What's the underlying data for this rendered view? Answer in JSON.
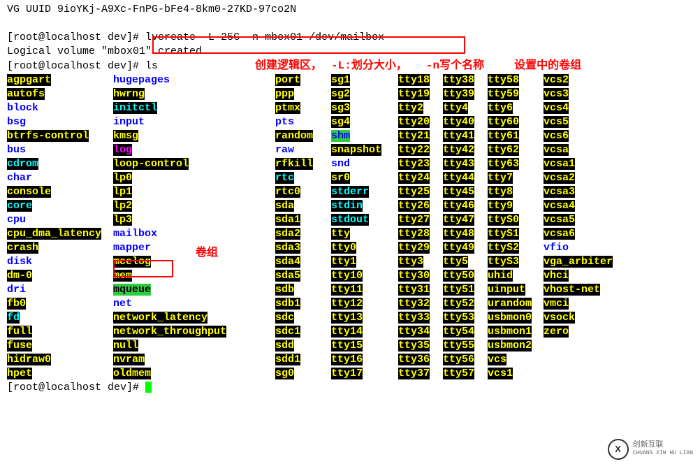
{
  "header_line": "  VG UUID               9ioYKj-A9Xc-FnPG-bFe4-8km0-27KD-97co2N",
  "prompt1": "[root@localhost dev]# ",
  "cmd1": "lvcreate -L 25G -n mbox01 /dev/mailbox",
  "result_line": "  Logical volume \"mbox01\" created.",
  "prompt2": "[root@localhost dev]# ",
  "cmd2": "ls",
  "anno_create": "创建逻辑区，",
  "anno_L": "-L:划分大小，",
  "anno_n": "-n写个名称",
  "anno_vg": "设置中的卷组",
  "anno_group": "卷组",
  "cols": [
    [
      {
        "t": "agpgart",
        "s": "hl yel"
      },
      {
        "t": "autofs",
        "s": "hl yel"
      },
      {
        "t": "block",
        "s": "blue"
      },
      {
        "t": "bsg",
        "s": "blue"
      },
      {
        "t": "btrfs-control",
        "s": "hl yel"
      },
      {
        "t": "bus",
        "s": "blue"
      },
      {
        "t": "cdrom",
        "s": "hl cyan"
      },
      {
        "t": "char",
        "s": "blue"
      },
      {
        "t": "console",
        "s": "hl yel"
      },
      {
        "t": "core",
        "s": "hl cyan"
      },
      {
        "t": "cpu",
        "s": "blue"
      },
      {
        "t": "cpu_dma_latency",
        "s": "hl yel"
      },
      {
        "t": "crash",
        "s": "hl yel"
      },
      {
        "t": "disk",
        "s": "blue"
      },
      {
        "t": "dm-0",
        "s": "hl yel"
      },
      {
        "t": "dri",
        "s": "blue"
      },
      {
        "t": "fb0",
        "s": "hl yel"
      },
      {
        "t": "fd",
        "s": "hl cyan"
      },
      {
        "t": "full",
        "s": "hl yel"
      },
      {
        "t": "fuse",
        "s": "hl yel"
      },
      {
        "t": "hidraw0",
        "s": "hl yel"
      },
      {
        "t": "hpet",
        "s": "hl yel"
      }
    ],
    [
      {
        "t": "hugepages",
        "s": "blue"
      },
      {
        "t": "hwrng",
        "s": "hl yel"
      },
      {
        "t": "initctl",
        "s": "hl cyan"
      },
      {
        "t": "input",
        "s": "blue"
      },
      {
        "t": "kmsg",
        "s": "hl yel"
      },
      {
        "t": "log",
        "s": "hl mag"
      },
      {
        "t": "loop-control",
        "s": "hl yel"
      },
      {
        "t": "lp0",
        "s": "hl yel"
      },
      {
        "t": "lp1",
        "s": "hl yel"
      },
      {
        "t": "lp2",
        "s": "hl yel"
      },
      {
        "t": "lp3",
        "s": "hl yel"
      },
      {
        "t": "mailbox",
        "s": "blue"
      },
      {
        "t": "mapper",
        "s": "blue"
      },
      {
        "t": "mcelog",
        "s": "hl yel"
      },
      {
        "t": "mem",
        "s": "hl yel"
      },
      {
        "t": "mqueue",
        "s": "grnbg"
      },
      {
        "t": "net",
        "s": "blue"
      },
      {
        "t": "network_latency",
        "s": "hl yel"
      },
      {
        "t": "network_throughput",
        "s": "hl yel"
      },
      {
        "t": "null",
        "s": "hl yel"
      },
      {
        "t": "nvram",
        "s": "hl yel"
      },
      {
        "t": "oldmem",
        "s": "hl yel"
      }
    ],
    [
      {
        "t": "port",
        "s": "hl yel"
      },
      {
        "t": "ppp",
        "s": "hl yel"
      },
      {
        "t": "ptmx",
        "s": "hl yel"
      },
      {
        "t": "pts",
        "s": "blue"
      },
      {
        "t": "random",
        "s": "hl yel"
      },
      {
        "t": "raw",
        "s": "blue"
      },
      {
        "t": "rfkill",
        "s": "hl yel"
      },
      {
        "t": "rtc",
        "s": "hl cyan"
      },
      {
        "t": "rtc0",
        "s": "hl yel"
      },
      {
        "t": "sda",
        "s": "hl yel"
      },
      {
        "t": "sda1",
        "s": "hl yel"
      },
      {
        "t": "sda2",
        "s": "hl yel"
      },
      {
        "t": "sda3",
        "s": "hl yel"
      },
      {
        "t": "sda4",
        "s": "hl yel"
      },
      {
        "t": "sda5",
        "s": "hl yel"
      },
      {
        "t": "sdb",
        "s": "hl yel"
      },
      {
        "t": "sdb1",
        "s": "hl yel"
      },
      {
        "t": "sdc",
        "s": "hl yel"
      },
      {
        "t": "sdc1",
        "s": "hl yel"
      },
      {
        "t": "sdd",
        "s": "hl yel"
      },
      {
        "t": "sdd1",
        "s": "hl yel"
      },
      {
        "t": "sg0",
        "s": "hl yel"
      }
    ],
    [
      {
        "t": "sg1",
        "s": "hl yel"
      },
      {
        "t": "sg2",
        "s": "hl yel"
      },
      {
        "t": "sg3",
        "s": "hl yel"
      },
      {
        "t": "sg4",
        "s": "hl yel"
      },
      {
        "t": "shm",
        "s": "shm"
      },
      {
        "t": "snapshot",
        "s": "hl yel"
      },
      {
        "t": "snd",
        "s": "blue"
      },
      {
        "t": "sr0",
        "s": "hl yel"
      },
      {
        "t": "stderr",
        "s": "hl cyan"
      },
      {
        "t": "stdin",
        "s": "hl cyan"
      },
      {
        "t": "stdout",
        "s": "hl cyan"
      },
      {
        "t": "tty",
        "s": "hl yel"
      },
      {
        "t": "tty0",
        "s": "hl yel"
      },
      {
        "t": "tty1",
        "s": "hl yel"
      },
      {
        "t": "tty10",
        "s": "hl yel"
      },
      {
        "t": "tty11",
        "s": "hl yel"
      },
      {
        "t": "tty12",
        "s": "hl yel"
      },
      {
        "t": "tty13",
        "s": "hl yel"
      },
      {
        "t": "tty14",
        "s": "hl yel"
      },
      {
        "t": "tty15",
        "s": "hl yel"
      },
      {
        "t": "tty16",
        "s": "hl yel"
      },
      {
        "t": "tty17",
        "s": "hl yel"
      }
    ],
    [
      {
        "t": "tty18",
        "s": "hl yel"
      },
      {
        "t": "tty19",
        "s": "hl yel"
      },
      {
        "t": "tty2",
        "s": "hl yel"
      },
      {
        "t": "tty20",
        "s": "hl yel"
      },
      {
        "t": "tty21",
        "s": "hl yel"
      },
      {
        "t": "tty22",
        "s": "hl yel"
      },
      {
        "t": "tty23",
        "s": "hl yel"
      },
      {
        "t": "tty24",
        "s": "hl yel"
      },
      {
        "t": "tty25",
        "s": "hl yel"
      },
      {
        "t": "tty26",
        "s": "hl yel"
      },
      {
        "t": "tty27",
        "s": "hl yel"
      },
      {
        "t": "tty28",
        "s": "hl yel"
      },
      {
        "t": "tty29",
        "s": "hl yel"
      },
      {
        "t": "tty3",
        "s": "hl yel"
      },
      {
        "t": "tty30",
        "s": "hl yel"
      },
      {
        "t": "tty31",
        "s": "hl yel"
      },
      {
        "t": "tty32",
        "s": "hl yel"
      },
      {
        "t": "tty33",
        "s": "hl yel"
      },
      {
        "t": "tty34",
        "s": "hl yel"
      },
      {
        "t": "tty35",
        "s": "hl yel"
      },
      {
        "t": "tty36",
        "s": "hl yel"
      },
      {
        "t": "tty37",
        "s": "hl yel"
      }
    ],
    [
      {
        "t": "tty38",
        "s": "hl yel"
      },
      {
        "t": "tty39",
        "s": "hl yel"
      },
      {
        "t": "tty4",
        "s": "hl yel"
      },
      {
        "t": "tty40",
        "s": "hl yel"
      },
      {
        "t": "tty41",
        "s": "hl yel"
      },
      {
        "t": "tty42",
        "s": "hl yel"
      },
      {
        "t": "tty43",
        "s": "hl yel"
      },
      {
        "t": "tty44",
        "s": "hl yel"
      },
      {
        "t": "tty45",
        "s": "hl yel"
      },
      {
        "t": "tty46",
        "s": "hl yel"
      },
      {
        "t": "tty47",
        "s": "hl yel"
      },
      {
        "t": "tty48",
        "s": "hl yel"
      },
      {
        "t": "tty49",
        "s": "hl yel"
      },
      {
        "t": "tty5",
        "s": "hl yel"
      },
      {
        "t": "tty50",
        "s": "hl yel"
      },
      {
        "t": "tty51",
        "s": "hl yel"
      },
      {
        "t": "tty52",
        "s": "hl yel"
      },
      {
        "t": "tty53",
        "s": "hl yel"
      },
      {
        "t": "tty54",
        "s": "hl yel"
      },
      {
        "t": "tty55",
        "s": "hl yel"
      },
      {
        "t": "tty56",
        "s": "hl yel"
      },
      {
        "t": "tty57",
        "s": "hl yel"
      }
    ],
    [
      {
        "t": "tty58",
        "s": "hl yel"
      },
      {
        "t": "tty59",
        "s": "hl yel"
      },
      {
        "t": "tty6",
        "s": "hl yel"
      },
      {
        "t": "tty60",
        "s": "hl yel"
      },
      {
        "t": "tty61",
        "s": "hl yel"
      },
      {
        "t": "tty62",
        "s": "hl yel"
      },
      {
        "t": "tty63",
        "s": "hl yel"
      },
      {
        "t": "tty7",
        "s": "hl yel"
      },
      {
        "t": "tty8",
        "s": "hl yel"
      },
      {
        "t": "tty9",
        "s": "hl yel"
      },
      {
        "t": "ttyS0",
        "s": "hl yel"
      },
      {
        "t": "ttyS1",
        "s": "hl yel"
      },
      {
        "t": "ttyS2",
        "s": "hl yel"
      },
      {
        "t": "ttyS3",
        "s": "hl yel"
      },
      {
        "t": "uhid",
        "s": "hl yel"
      },
      {
        "t": "uinput",
        "s": "hl yel"
      },
      {
        "t": "urandom",
        "s": "hl yel"
      },
      {
        "t": "usbmon0",
        "s": "hl yel"
      },
      {
        "t": "usbmon1",
        "s": "hl yel"
      },
      {
        "t": "usbmon2",
        "s": "hl yel"
      },
      {
        "t": "vcs",
        "s": "hl yel"
      },
      {
        "t": "vcs1",
        "s": "hl yel"
      }
    ],
    [
      {
        "t": "vcs2",
        "s": "hl yel"
      },
      {
        "t": "vcs3",
        "s": "hl yel"
      },
      {
        "t": "vcs4",
        "s": "hl yel"
      },
      {
        "t": "vcs5",
        "s": "hl yel"
      },
      {
        "t": "vcs6",
        "s": "hl yel"
      },
      {
        "t": "vcsa",
        "s": "hl yel"
      },
      {
        "t": "vcsa1",
        "s": "hl yel"
      },
      {
        "t": "vcsa2",
        "s": "hl yel"
      },
      {
        "t": "vcsa3",
        "s": "hl yel"
      },
      {
        "t": "vcsa4",
        "s": "hl yel"
      },
      {
        "t": "vcsa5",
        "s": "hl yel"
      },
      {
        "t": "vcsa6",
        "s": "hl yel"
      },
      {
        "t": "vfio",
        "s": "blue"
      },
      {
        "t": "vga_arbiter",
        "s": "hl yel"
      },
      {
        "t": "vhci",
        "s": "hl yel"
      },
      {
        "t": "vhost-net",
        "s": "hl yel"
      },
      {
        "t": "vmci",
        "s": "hl yel"
      },
      {
        "t": "vsock",
        "s": "hl yel"
      },
      {
        "t": "zero",
        "s": "hl yel"
      },
      {
        "t": "",
        "s": ""
      },
      {
        "t": "",
        "s": ""
      },
      {
        "t": "",
        "s": ""
      }
    ]
  ],
  "prompt3": "[root@localhost dev]# ",
  "logo_cn": "创新互联",
  "logo_en": "CHUANG XIN HU LIAN"
}
